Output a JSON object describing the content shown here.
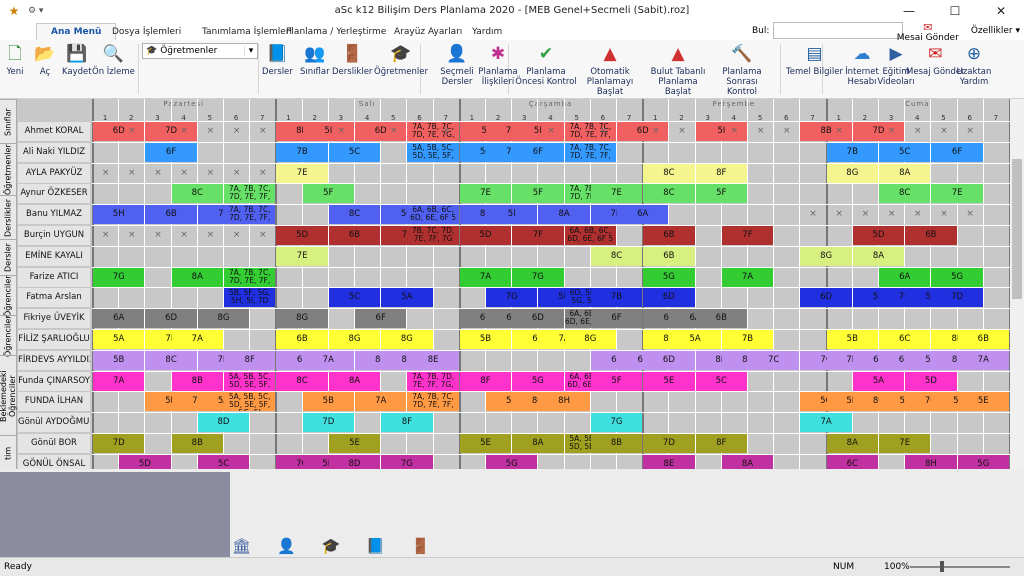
{
  "window": {
    "title": "aSc k12 Bilişim Ders Planlama 2020  - [MEB Genel+Secmeli (Sabit).roz]"
  },
  "tabs": [
    "Ana Menü",
    "Dosya İşlemleri",
    "Tanımlama İşlemleri",
    "Planlama / Yerleştirme",
    "Arayüz Ayarları",
    "Yardım"
  ],
  "search_label": "Bul:",
  "send_message": "Mesaj Gönder",
  "settings": "Özellikler ▾",
  "ribbon": {
    "dropdown": "Öğretmenler",
    "buttons": [
      {
        "label": "Yeni",
        "icon": "new-file-icon",
        "glyph": "🗋",
        "color": "#2a8a2a"
      },
      {
        "label": "Aç",
        "icon": "open-folder-icon",
        "glyph": "📂",
        "color": "#d8a020"
      },
      {
        "label": "Kaydet",
        "icon": "save-icon",
        "glyph": "💾",
        "color": "#3060a0"
      },
      {
        "label": "Ön İzleme",
        "icon": "print-preview-icon",
        "glyph": "🔍",
        "color": "#606060"
      },
      {
        "label": "Dersler",
        "icon": "book-icon",
        "glyph": "📘",
        "color": "#2050a0"
      },
      {
        "label": "Sınıflar",
        "icon": "students-icon",
        "glyph": "👥",
        "color": "#d07030"
      },
      {
        "label": "Derslikler",
        "icon": "door-icon",
        "glyph": "🚪",
        "color": "#a04020"
      },
      {
        "label": "Öğretmenler",
        "icon": "teacher-icon",
        "glyph": "🎓",
        "color": "#303030"
      },
      {
        "label": "Seçmeli Dersler",
        "icon": "elective-icon",
        "glyph": "👤",
        "color": "#3070c0"
      },
      {
        "label": "Planlama İlişkileri",
        "icon": "relations-icon",
        "glyph": "✱",
        "color": "#c03090"
      },
      {
        "label": "Planlama Öncesi Kontrol",
        "icon": "check-icon",
        "glyph": "✔",
        "color": "#30a040"
      },
      {
        "label": "Otomatik Planlamayı Başlat",
        "icon": "auto-plan-icon",
        "glyph": "▲",
        "color": "#d03030"
      },
      {
        "label": "Bulut Tabanlı Planlama Başlat",
        "icon": "cloud-plan-icon",
        "glyph": "▲",
        "color": "#d03030"
      },
      {
        "label": "Planlama Sonrası Kontrol",
        "icon": "gavel-icon",
        "glyph": "🔨",
        "color": "#c07020"
      },
      {
        "label": "Temel Bilgiler",
        "icon": "basic-info-icon",
        "glyph": "▤",
        "color": "#2060a0"
      },
      {
        "label": "İnternet Hesabı",
        "icon": "cloud-icon",
        "glyph": "☁",
        "color": "#3080d0"
      },
      {
        "label": "Eğitim Videoları",
        "icon": "video-icon",
        "glyph": "▶",
        "color": "#3060a0"
      },
      {
        "label": "Mesaj Gönder",
        "icon": "message-icon",
        "glyph": "✉",
        "color": "#d02020"
      },
      {
        "label": "Uzaktan Yardım",
        "icon": "remote-help-icon",
        "glyph": "⊕",
        "color": "#2060a0"
      }
    ]
  },
  "vertical_tabs": [
    "Sınıflar",
    "Öğretmenler",
    "Derslikler",
    "Dersler",
    "Öğrenciler",
    "Öğrenciler",
    "Beklemedeki Öğrenciler",
    "tim"
  ],
  "days": [
    "Pazartesi",
    "Salı",
    "Çarşamba",
    "Perşembe",
    "Cuma"
  ],
  "periods": [
    "1",
    "2",
    "3",
    "4",
    "5",
    "6",
    "7"
  ],
  "colors": {
    "Ahmet KORAL": "#f06060",
    "Ali Naki YILDIZ": "#3399ff",
    "AYLA PAKYÜZ": "#f5f590",
    "Aynur ÖZKESER": "#66e066",
    "Banu YILMAZ": "#5060f0",
    "Burçin UYGUN": "#b03030",
    "EMİNE KAYALI": "#d8f080",
    "Farize ATICI": "#33cc33",
    "Fatma Arslan": "#2030e0",
    "Fikriye ÜVEYİK": "#808080",
    "FİLİZ ŞARLIOĞLU": "#ffff33",
    "FİRDEVS AYYILDIZ": "#c090f0",
    "Funda ÇINARSOY": "#ff33cc",
    "FUNDA İLHAN": "#ff9944",
    "Gönül AYDOĞMUŞ": "#40e0e0",
    "Gönül BOR": "#a0a020",
    "GÖNÜL ÖNSAL": "#c030a0"
  },
  "teachers": [
    {
      "name": "Ahmet KORAL",
      "cells": [
        [
          0,
          "6D"
        ],
        [
          1,
          "x"
        ],
        [
          2,
          "7D"
        ],
        [
          3,
          "x"
        ],
        [
          4,
          "x"
        ],
        [
          5,
          "x"
        ],
        [
          6,
          "x"
        ],
        [
          7,
          "8D"
        ],
        [
          8,
          "5I"
        ],
        [
          9,
          "x"
        ],
        [
          10,
          "6D"
        ],
        [
          11,
          "x"
        ],
        [
          12,
          "7A, 7B, 7C, 7D, 7E, 7G, "
        ],
        [
          13,
          "x"
        ],
        [
          14,
          "5I"
        ],
        [
          15,
          "7D"
        ],
        [
          16,
          "5I"
        ],
        [
          17,
          "x"
        ],
        [
          18,
          "7A, 7B, 7C, 7D, 7E, 7F, "
        ],
        [
          19,
          "x"
        ],
        [
          20,
          "6D"
        ],
        [
          21,
          "x"
        ],
        [
          22,
          "x"
        ],
        [
          23,
          "5I"
        ],
        [
          24,
          "x"
        ],
        [
          25,
          "x"
        ],
        [
          26,
          "x"
        ],
        [
          27,
          "8B"
        ],
        [
          28,
          "x"
        ],
        [
          29,
          "7D"
        ],
        [
          30,
          "x"
        ],
        [
          31,
          "x"
        ],
        [
          32,
          "x"
        ],
        [
          33,
          "x"
        ]
      ]
    },
    {
      "name": "Ali Naki YILDIZ",
      "cells": [
        [
          2,
          "6F"
        ],
        [
          7,
          "7B"
        ],
        [
          9,
          "5C"
        ],
        [
          12,
          "5A, 5B, 5C, 5D, 5E, 5F, "
        ],
        [
          14,
          "5C"
        ],
        [
          15,
          "7B"
        ],
        [
          16,
          "6F"
        ],
        [
          18,
          "7A, 7B, 7C, 7D, 7E, 7F, "
        ],
        [
          28,
          "7B"
        ],
        [
          30,
          "5C"
        ],
        [
          32,
          "6F"
        ]
      ]
    },
    {
      "name": "AYLA PAKYÜZ",
      "cells": [
        [
          0,
          "x"
        ],
        [
          1,
          "x"
        ],
        [
          2,
          "x"
        ],
        [
          3,
          "x"
        ],
        [
          4,
          "x"
        ],
        [
          5,
          "x"
        ],
        [
          6,
          "x"
        ],
        [
          7,
          "7E"
        ],
        [
          21,
          "8C"
        ],
        [
          23,
          "8F"
        ],
        [
          28,
          "8G"
        ],
        [
          30,
          "8A"
        ]
      ]
    },
    {
      "name": "Aynur ÖZKESER",
      "cells": [
        [
          3,
          "8C"
        ],
        [
          5,
          "7A, 7B, 7C, 7D, 7E, 7F, "
        ],
        [
          8,
          "5F"
        ],
        [
          14,
          "7E"
        ],
        [
          16,
          "5F"
        ],
        [
          18,
          "7A, 7B, 7C, 7D, 7E, 7F, "
        ],
        [
          19,
          "7E"
        ],
        [
          21,
          "8C"
        ],
        [
          23,
          "5F"
        ],
        [
          30,
          "8C"
        ],
        [
          32,
          "7E"
        ]
      ]
    },
    {
      "name": "Banu YILMAZ",
      "cells": [
        [
          0,
          "5H"
        ],
        [
          2,
          "6B"
        ],
        [
          4,
          "7E"
        ],
        [
          5,
          "7A, 7B, 7C, 7D, 7E, 7F, "
        ],
        [
          9,
          "8C"
        ],
        [
          11,
          "5G"
        ],
        [
          12,
          "6A, 6B, 6C, 6D, 6E, 6F 5"
        ],
        [
          14,
          "8B"
        ],
        [
          15,
          "5I"
        ],
        [
          17,
          "8A"
        ],
        [
          19,
          "7D"
        ],
        [
          20,
          "6A"
        ],
        [
          27,
          "x"
        ],
        [
          28,
          "x"
        ],
        [
          29,
          "x"
        ],
        [
          30,
          "x"
        ],
        [
          31,
          "x"
        ],
        [
          32,
          "x"
        ],
        [
          33,
          "x"
        ]
      ]
    },
    {
      "name": "Burçin UYGUN",
      "cells": [
        [
          0,
          "x"
        ],
        [
          1,
          "x"
        ],
        [
          2,
          "x"
        ],
        [
          3,
          "x"
        ],
        [
          4,
          "x"
        ],
        [
          5,
          "x"
        ],
        [
          6,
          "x"
        ],
        [
          7,
          "5D"
        ],
        [
          9,
          "6B"
        ],
        [
          11,
          "7F"
        ],
        [
          12,
          "7B, 7C, 7D, 7E, 7F, 7G"
        ],
        [
          14,
          "5D"
        ],
        [
          16,
          "7F"
        ],
        [
          18,
          "6A, 6B, 6C, 6D, 6E, 6F 5"
        ],
        [
          21,
          "6B"
        ],
        [
          24,
          "7F"
        ],
        [
          29,
          "5D"
        ],
        [
          31,
          "6B"
        ]
      ]
    },
    {
      "name": "EMİNE KAYALI",
      "cells": [
        [
          7,
          "7E"
        ],
        [
          19,
          "8C"
        ],
        [
          21,
          "6B"
        ],
        [
          27,
          "8G"
        ],
        [
          29,
          "8A"
        ]
      ]
    },
    {
      "name": "Farize ATICI",
      "cells": [
        [
          0,
          "7G"
        ],
        [
          3,
          "8A"
        ],
        [
          5,
          "7A, 7B, 7C, 7D, 7E, 7F, "
        ],
        [
          14,
          "7A"
        ],
        [
          16,
          "7G"
        ],
        [
          21,
          "5G"
        ],
        [
          24,
          "7A"
        ],
        [
          30,
          "6A"
        ],
        [
          32,
          "5G"
        ]
      ]
    },
    {
      "name": "Fatma Arslan",
      "cells": [
        [
          5,
          "5B, 5F, 5G, 5H, 5I, 7D"
        ],
        [
          9,
          "5C"
        ],
        [
          11,
          "5A"
        ],
        [
          15,
          "7G"
        ],
        [
          17,
          "5H"
        ],
        [
          18,
          "6D, 5E, 5F, 5G, 5H, 5I"
        ],
        [
          19,
          "7B"
        ],
        [
          21,
          "6D"
        ],
        [
          27,
          "6D"
        ],
        [
          29,
          "5H"
        ],
        [
          30,
          "7G"
        ],
        [
          31,
          "5E"
        ],
        [
          32,
          "7D"
        ]
      ]
    },
    {
      "name": "Fikriye ÜVEYİK",
      "cells": [
        [
          0,
          "6A"
        ],
        [
          2,
          "6D"
        ],
        [
          4,
          "8G"
        ],
        [
          7,
          "8G"
        ],
        [
          10,
          "6F"
        ],
        [
          14,
          "6B"
        ],
        [
          15,
          "6E"
        ],
        [
          16,
          "6D"
        ],
        [
          18,
          "6A, 6B, 6C, 6D, 6E, 6F 10"
        ],
        [
          19,
          "6F"
        ],
        [
          21,
          "6E"
        ],
        [
          22,
          "6A"
        ],
        [
          23,
          "6B"
        ]
      ]
    },
    {
      "name": "FİLİZ ŞARLIOĞLU",
      "cells": [
        [
          0,
          "5A"
        ],
        [
          2,
          "7B"
        ],
        [
          3,
          "7A"
        ],
        [
          7,
          "6B"
        ],
        [
          9,
          "8G"
        ],
        [
          11,
          "8G"
        ],
        [
          14,
          "5B"
        ],
        [
          16,
          "6C"
        ],
        [
          17,
          "7A"
        ],
        [
          18,
          "8G"
        ],
        [
          21,
          "8B"
        ],
        [
          22,
          "5A"
        ],
        [
          24,
          "7B"
        ],
        [
          28,
          "5B"
        ],
        [
          30,
          "6C"
        ],
        [
          32,
          "8B"
        ],
        [
          33,
          "6B"
        ]
      ]
    },
    {
      "name": "FİRDEVS AYYILDIZ",
      "cells": [
        [
          0,
          "5B"
        ],
        [
          2,
          "8C"
        ],
        [
          4,
          "7D"
        ],
        [
          5,
          "8F"
        ],
        [
          7,
          "6F"
        ],
        [
          8,
          "7A"
        ],
        [
          10,
          "8C"
        ],
        [
          11,
          "8E"
        ],
        [
          12,
          "8E"
        ],
        [
          19,
          "6E"
        ],
        [
          20,
          "6F"
        ],
        [
          21,
          "6D"
        ],
        [
          23,
          "8D"
        ],
        [
          24,
          "8E"
        ],
        [
          25,
          "7C"
        ],
        [
          27,
          "7C"
        ],
        [
          28,
          "7D"
        ],
        [
          29,
          "6E"
        ],
        [
          30,
          "6D"
        ],
        [
          31,
          "5B"
        ],
        [
          32,
          "8F"
        ],
        [
          33,
          "7A"
        ]
      ]
    },
    {
      "name": "Funda ÇINARSOY",
      "cells": [
        [
          0,
          "7A"
        ],
        [
          3,
          "8B"
        ],
        [
          5,
          "5A, 5B, 5C, 5D, 5E, 5F, "
        ],
        [
          7,
          "8C"
        ],
        [
          9,
          "8A"
        ],
        [
          12,
          "7A, 7B, 7D, 7E, 7F, 7G, "
        ],
        [
          14,
          "8F"
        ],
        [
          16,
          "5G"
        ],
        [
          18,
          "6A, 6B, 6C, 6D, 6E, 6F 9"
        ],
        [
          19,
          "5F"
        ],
        [
          21,
          "5E"
        ],
        [
          23,
          "5C"
        ],
        [
          29,
          "5A"
        ],
        [
          31,
          "5D"
        ]
      ]
    },
    {
      "name": "FUNDA İLHAN",
      "cells": [
        [
          2,
          "5D"
        ],
        [
          3,
          "7F"
        ],
        [
          4,
          "5A"
        ],
        [
          5,
          "5A, 5B, 5C, 5D, 5E, 5F, 5G, 5I"
        ],
        [
          8,
          "5B"
        ],
        [
          10,
          "7A"
        ],
        [
          12,
          "7A, 7B, 7C, 7D, 7E, 7F, "
        ],
        [
          15,
          "5C"
        ],
        [
          16,
          "8G"
        ],
        [
          17,
          "8H"
        ],
        [
          27,
          "5G"
        ],
        [
          28,
          "5H"
        ],
        [
          29,
          "8C"
        ],
        [
          30,
          "5F"
        ],
        [
          31,
          "7G"
        ],
        [
          32,
          "5I"
        ],
        [
          33,
          "5E"
        ]
      ]
    },
    {
      "name": "Gönül AYDOĞMUŞ",
      "cells": [
        [
          4,
          "8D"
        ],
        [
          8,
          "7D"
        ],
        [
          11,
          "8F"
        ],
        [
          19,
          "7G"
        ],
        [
          27,
          "7A"
        ]
      ]
    },
    {
      "name": "Gönül BOR",
      "cells": [
        [
          0,
          "7D"
        ],
        [
          3,
          "8B"
        ],
        [
          9,
          "5E"
        ],
        [
          14,
          "5E"
        ],
        [
          16,
          "8A"
        ],
        [
          18,
          "5A, 5B, 5C, 5D, 5E, 5H, "
        ],
        [
          19,
          "8B"
        ],
        [
          21,
          "7D"
        ],
        [
          23,
          "8F"
        ],
        [
          28,
          "8A"
        ],
        [
          30,
          "7E"
        ]
      ]
    },
    {
      "name": "GÖNÜL ÖNSAL",
      "cells": [
        [
          1,
          "5D"
        ],
        [
          4,
          "5C"
        ],
        [
          7,
          "7G"
        ],
        [
          8,
          "5H"
        ],
        [
          9,
          "8D"
        ],
        [
          11,
          "7G"
        ],
        [
          15,
          "5G"
        ],
        [
          21,
          "8E"
        ],
        [
          24,
          "8A"
        ],
        [
          28,
          "6C"
        ],
        [
          31,
          "8H"
        ],
        [
          33,
          "5G"
        ]
      ]
    }
  ],
  "bottom_icons": [
    "school-icon",
    "person-icon",
    "graduation-icon",
    "book-icon",
    "door-icon"
  ],
  "status": {
    "ready": "Ready",
    "num": "NUM",
    "zoom": "100%"
  }
}
